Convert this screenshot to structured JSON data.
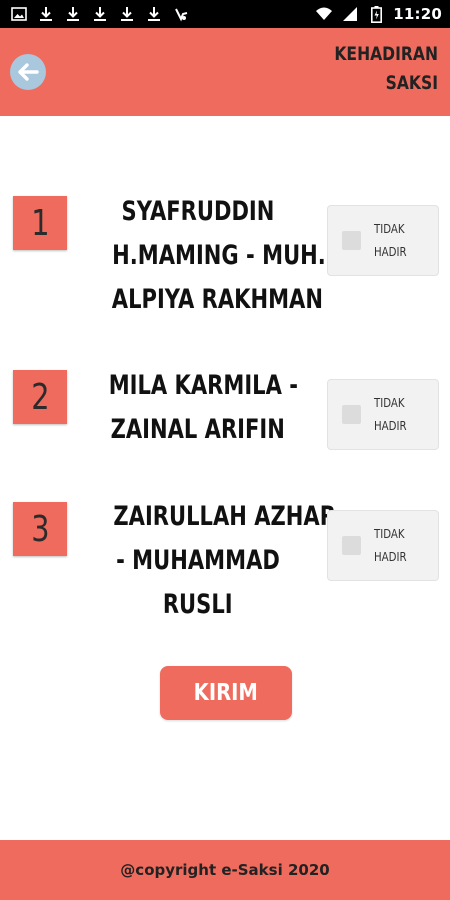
{
  "status_bar": {
    "time": "11:20",
    "left_icons": [
      "image-icon",
      "download-icon",
      "download-icon",
      "download-icon",
      "download-icon",
      "download-icon",
      "app-notification-icon"
    ],
    "right_icons": [
      "wifi-icon",
      "signal-icon",
      "battery-icon"
    ]
  },
  "header": {
    "title_line1": "KEHADIRAN",
    "title_line2": "SAKSI",
    "back_icon": "arrow-left-icon"
  },
  "witnesses": [
    {
      "number": "1",
      "name_lines": [
        "SYAFRUDDIN",
        "H.MAMING - MUH.",
        "ALPIYA RAKHMAN"
      ],
      "status_lines": [
        "TIDAK",
        "HADIR"
      ],
      "checked": false
    },
    {
      "number": "2",
      "name_lines": [
        "MILA KARMILA -",
        "ZAINAL ARIFIN"
      ],
      "status_lines": [
        "TIDAK",
        "HADIR"
      ],
      "checked": false
    },
    {
      "number": "3",
      "name_lines": [
        "ZAIRULLAH AZHAR",
        "- MUHAMMAD",
        "RUSLI"
      ],
      "status_lines": [
        "TIDAK",
        "HADIR"
      ],
      "checked": false
    }
  ],
  "submit": {
    "label": "KIRIM"
  },
  "footer": {
    "text": "@copyright e-Saksi 2020"
  },
  "colors": {
    "accent": "#ef6b5d",
    "back_button": "#a9c7dd",
    "checkbox_box": "#f2f2f2"
  }
}
